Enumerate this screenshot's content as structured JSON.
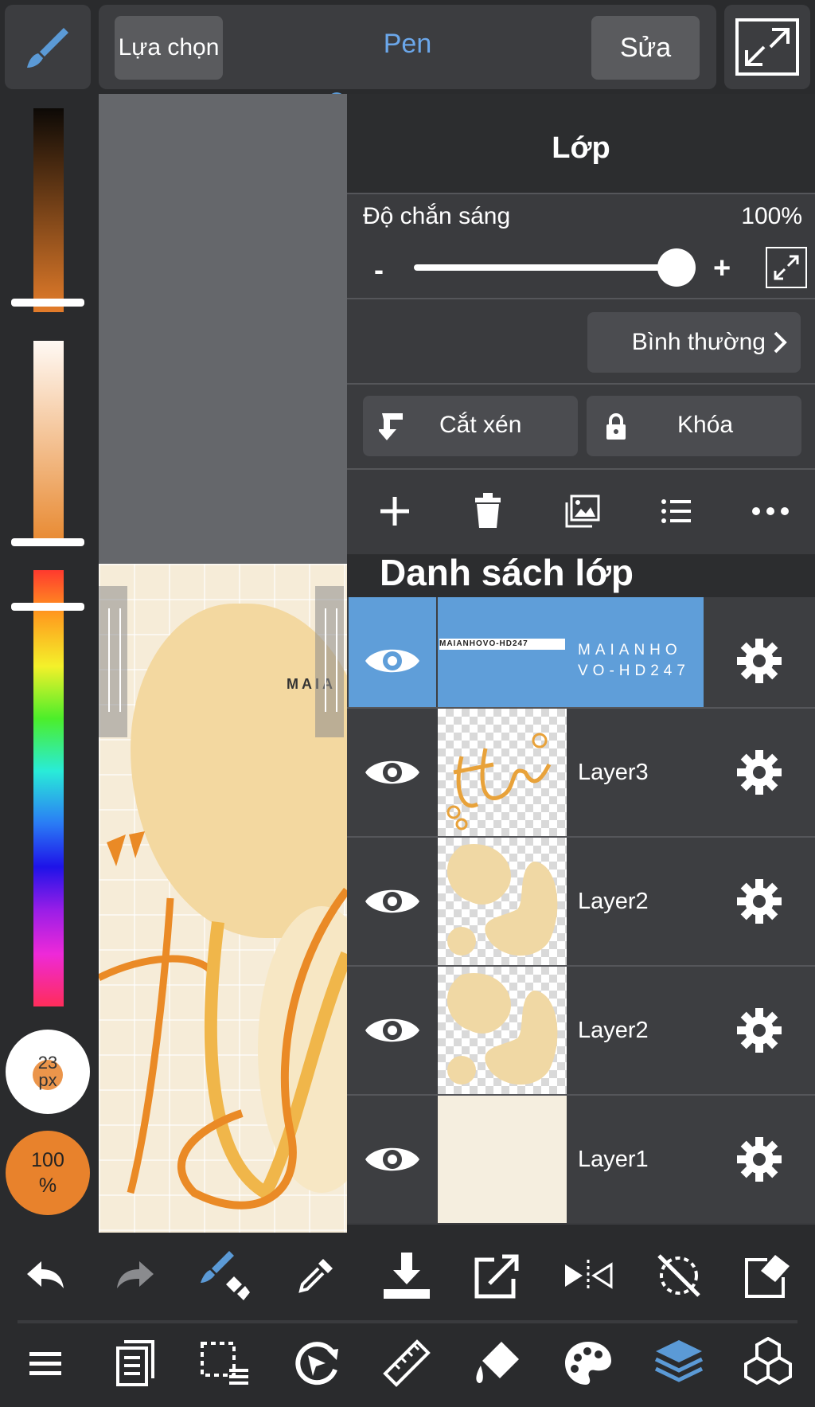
{
  "toolbar": {
    "select_label": "Lựa chọn",
    "tool_label": "Pen",
    "edit_label": "Sửa"
  },
  "brush": {
    "size_value": "23",
    "size_unit": "px",
    "opacity_value": "100",
    "opacity_unit": "%"
  },
  "canvas": {
    "text_fragment": "MAIA"
  },
  "layer_panel": {
    "title": "Lớp",
    "opacity_label": "Độ chắn sáng",
    "opacity_value": "100%",
    "minus": "-",
    "plus": "+",
    "blend_mode": "Bình thường",
    "clip_label": "Cắt xén",
    "lock_label": "Khóa",
    "list_title": "Danh sách lớp",
    "layers": [
      {
        "name": "MAIANHO VO-HD247",
        "thumb_text": "MAIANHOVO-HD247",
        "selected": true
      },
      {
        "name": "Layer3",
        "selected": false
      },
      {
        "name": "Layer2",
        "selected": false
      },
      {
        "name": "Layer2",
        "selected": false
      },
      {
        "name": "Layer1",
        "selected": false
      }
    ]
  },
  "colors": {
    "accent_blue": "#6ba7ea",
    "selected_layer": "#5f9ed9",
    "brush_orange": "#e8822c",
    "panel_bg": "#3a3b3e"
  },
  "icons": {
    "top": [
      "brush-icon",
      "fullscreen-icon"
    ],
    "bottom_row1": [
      "undo-icon",
      "redo-icon",
      "brush-transform-icon",
      "eyedropper-icon",
      "save-download-icon",
      "export-icon",
      "flip-icon",
      "rotate-lock-icon",
      "eraser-icon"
    ],
    "bottom_row2": [
      "menu-icon",
      "pages-icon",
      "selection-icon",
      "transform-icon",
      "ruler-icon",
      "fill-icon",
      "palette-icon",
      "layers-icon",
      "materials-icon"
    ]
  }
}
